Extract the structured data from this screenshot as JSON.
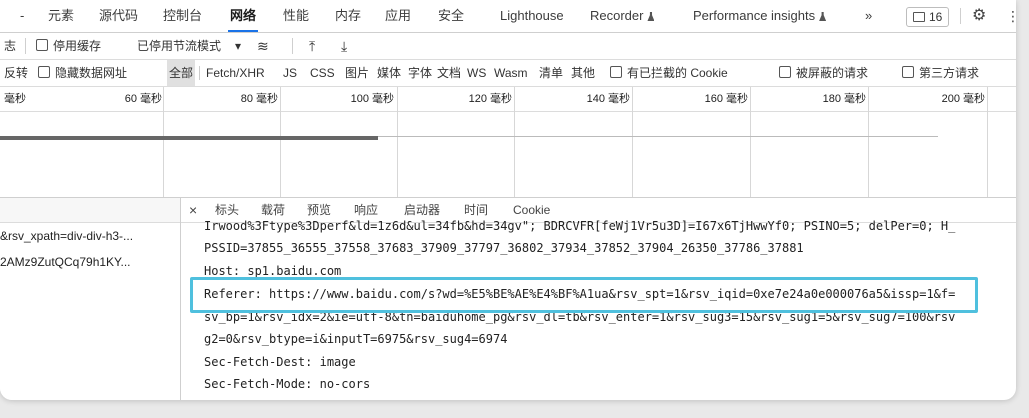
{
  "tabbar": {
    "partial_prev": "-",
    "tabs": [
      "元素",
      "源代码",
      "控制台",
      "网络",
      "性能",
      "内存",
      "应用",
      "安全",
      "Lighthouse",
      "Recorder",
      "Performance insights",
      "»"
    ],
    "active_tab": "网络",
    "issues_count": "16"
  },
  "toolbar": {
    "partial": "志",
    "disable_cache": "停用缓存",
    "throttle": "已停用节流模式",
    "dropdown_arrow": "▾"
  },
  "filterbar": {
    "partial": "反转",
    "hide_data_urls": "隐藏数据网址",
    "types": [
      "全部",
      "Fetch/XHR",
      "JS",
      "CSS",
      "图片",
      "媒体",
      "字体",
      "文档",
      "WS",
      "Wasm",
      "清单",
      "其他"
    ],
    "selected_type": "全部",
    "blocked_cookies": "有已拦截的 Cookie",
    "blocked_requests": "被屏蔽的请求",
    "third_party": "第三方请求"
  },
  "timeline": {
    "ticks": [
      "毫秒",
      "60 毫秒",
      "80 毫秒",
      "100 毫秒",
      "120 毫秒",
      "140 毫秒",
      "160 毫秒",
      "180 毫秒",
      "200 毫秒"
    ]
  },
  "request_list": {
    "rows": [
      "&rsv_xpath=div-div-h3-...",
      "2AMz9ZutQCq79h1KY..."
    ]
  },
  "details": {
    "close": "×",
    "tabs": [
      "标头",
      "载荷",
      "预览",
      "响应",
      "启动器",
      "时间",
      "Cookie"
    ],
    "lines": [
      "Irwood%3Ftype%3Dperf&ld=1z6d&ul=34fb&hd=34gv\"; BDRCVFR[feWj1Vr5u3D]=I67x6TjHwwYf0; PSINO=5; delPer=0; H_",
      "PSSID=37855_36555_37558_37683_37909_37797_36802_37934_37852_37904_26350_37786_37881",
      "Host: sp1.baidu.com",
      "Referer: https://www.baidu.com/s?wd=%E5%BE%AE%E4%BF%A1ua&rsv_spt=1&rsv_iqid=0xe7e24a0e000076a5&issp=1&f=",
      "sv_bp=1&rsv_idx=2&ie=utf-8&tn=baiduhome_pg&rsv_dl=tb&rsv_enter=1&rsv_sug3=15&rsv_sug1=5&rsv_sug7=100&rsv",
      "g2=0&rsv_btype=i&inputT=6975&rsv_sug4=6974",
      "Sec-Fetch-Dest: image",
      "Sec-Fetch-Mode: no-cors"
    ]
  },
  "colors": {
    "highlight": "#4fc0de",
    "active_underline": "#1a73e8"
  }
}
